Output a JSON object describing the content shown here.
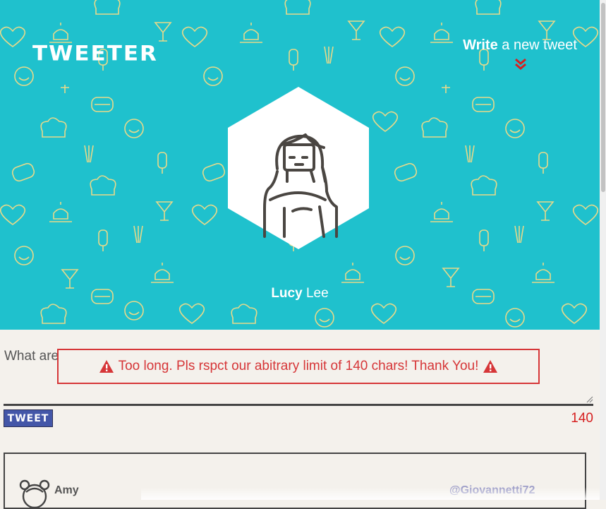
{
  "header": {
    "logo": "TWEETER",
    "compose_link_bold": "Write",
    "compose_link_rest": " a new tweet",
    "profile_first": "Lucy",
    "profile_last": " Lee"
  },
  "composer": {
    "prompt": "What are",
    "error_message": "Too long. Pls rspct our abitrary limit of 140 chars! Thank You!",
    "button_label": "TWEET",
    "char_counter": "140"
  },
  "tweets": [
    {
      "author": "Amy",
      "handle": "@Giovannetti72"
    }
  ],
  "colors": {
    "hero_bg": "#1fc1cd",
    "pattern": "#e8d98a",
    "error": "#d63638",
    "button": "#4356a8",
    "accent_chevron": "#d62020"
  },
  "icons": {
    "compose": "chevron-double-down-icon",
    "warning": "warning-icon",
    "avatar": "woman-avatar-icon"
  }
}
